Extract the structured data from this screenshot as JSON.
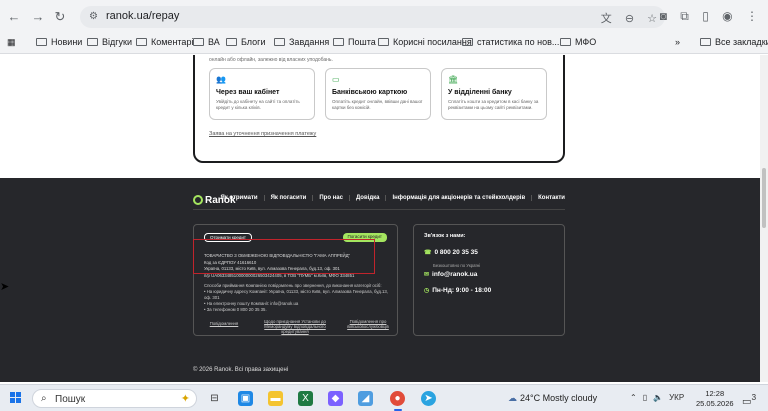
{
  "browser": {
    "url": "ranok.ua/repay",
    "bookmarks": [
      "Новини",
      "Відгуки",
      "Коментарі",
      "ВА",
      "Блоги",
      "Завдання",
      "Пошта",
      "Корисні посилання",
      "статистика по нов...",
      "МФО"
    ],
    "all_bookmarks": "Все закладки",
    "more": "»"
  },
  "payment": {
    "intro": "Процес погашення кредиту в Ranok є простим і зручним для кожного клієнта. Ви можете обрати один із кількох доступних способів сплати — онлайн або офлайн, залежно від власних уподобань.",
    "methods": [
      {
        "title": "Через ваш кабінет",
        "desc": "Увійдіть до кабінету на сайті та оплатіть кредит у кілька кліків."
      },
      {
        "title": "Банківською карткою",
        "desc": "Оплатіть кредит онлайн, ввівши дані вашої картки без комісій."
      },
      {
        "title": "У відділенні банку",
        "desc": "Сплатіть кошти за кредитом в касі банку за реквізитами на цьому сайті реквізитами."
      }
    ],
    "link": "Заява на уточнення призначення платежу"
  },
  "footer": {
    "logo": "Ranok",
    "nav": [
      "Як отримати",
      "Як погасити",
      "Про нас",
      "Довідка",
      "Інформація для акціонерів та стейкхолдерів",
      "Контакти"
    ],
    "get_credit": "Отримати кредит",
    "repay_credit": "Погасити кредит",
    "company_lines": [
      "ТОВАРИСТВО З ОБМЕЖЕНОЮ ВІДПОВІДАЛЬНІСТЮ \"ГАМА АППРЕЙД\"",
      "Код за ЄДРПОУ 41616610",
      "Україна, 01133, місто Київ, вул. Алмазова Генерала, буд.13, оф. 301",
      "п/р UA063348510000000026503424405, в ТОВ \"ПУМБ\" м.Київ, МФО 334851"
    ],
    "consumer_lines": [
      "Способи приймання Компанією повідомлень про звернення, до виконання категорії осіб:",
      "• На юридичну адресу Компанії: Україна, 01133, місто Київ, вул. Алмазова Генерала, буд.13, оф. 301",
      "• На електронну пошту Компанії: info@ranok.ua",
      "• За телефоном 0 800 20 35 35."
    ],
    "links": [
      "Повідомлення",
      "Щодо приєднання Установи до Меморандуму відповідального кредитування",
      "Повідомлення про військовослужбовців"
    ],
    "contact_title": "Зв'язок з нами:",
    "phone": "0 800 20 35 35",
    "phone_note": "Безкоштовно по Україні",
    "email": "info@ranok.ua",
    "hours": "Пн-Нд: 9:00 - 18:00",
    "copyright": "© 2026 Ranok. Всі права захищені"
  },
  "taskbar": {
    "search": "Пошук",
    "weather": "24°C  Mostly cloudy",
    "lang": "УКР",
    "time": "12:28",
    "date": "25.05.2026",
    "notifications": "3"
  }
}
